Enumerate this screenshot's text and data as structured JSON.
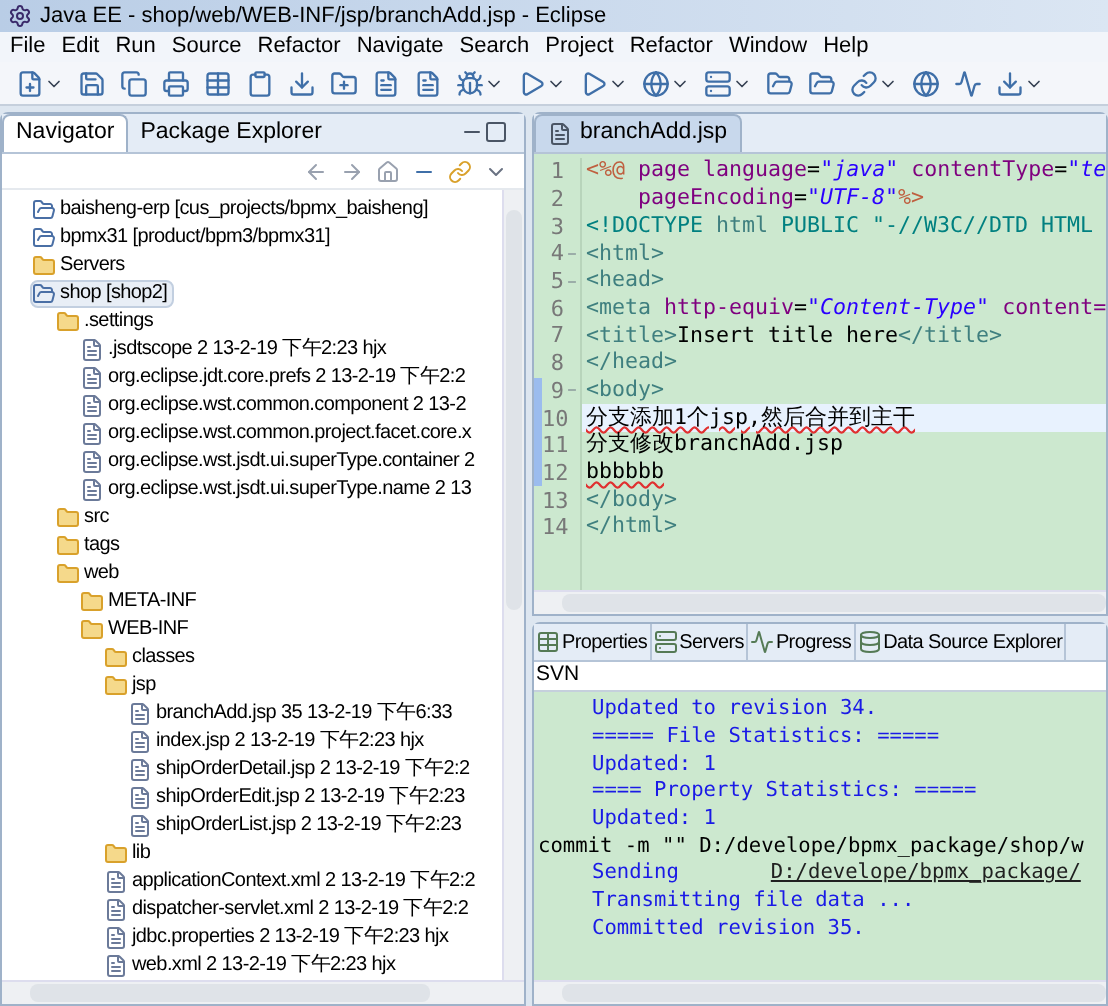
{
  "window": {
    "title": "Java EE - shop/web/WEB-INF/jsp/branchAdd.jsp - Eclipse"
  },
  "menu": [
    "File",
    "Edit",
    "Run",
    "Source",
    "Refactor",
    "Navigate",
    "Search",
    "Project",
    "Refactor",
    "Window",
    "Help"
  ],
  "navigator": {
    "tabs": [
      {
        "label": "Navigator",
        "selected": true
      },
      {
        "label": "Package Explorer",
        "selected": false
      }
    ],
    "tree": [
      {
        "label": "baisheng-erp [cus_projects/bpmx_baisheng]",
        "kind": "project",
        "selected": false
      },
      {
        "label": "bpmx31 [product/bpm3/bpmx31]",
        "kind": "project",
        "selected": false
      },
      {
        "label": "Servers",
        "kind": "folder",
        "selected": false
      },
      {
        "label": "shop [shop2]",
        "kind": "project",
        "selected": true,
        "children": [
          {
            "label": ".settings",
            "kind": "folder",
            "selected": false,
            "children": [
              {
                "label": ".jsdtscope 2  13-2-19 下午2:23  hjx",
                "kind": "file",
                "selected": false
              },
              {
                "label": "org.eclipse.jdt.core.prefs 2  13-2-19 下午2:2",
                "kind": "file",
                "selected": false
              },
              {
                "label": "org.eclipse.wst.common.component 2  13-2",
                "kind": "file",
                "selected": false
              },
              {
                "label": "org.eclipse.wst.common.project.facet.core.x",
                "kind": "file",
                "selected": false
              },
              {
                "label": "org.eclipse.wst.jsdt.ui.superType.container 2",
                "kind": "file",
                "selected": false
              },
              {
                "label": "org.eclipse.wst.jsdt.ui.superType.name 2  13",
                "kind": "file",
                "selected": false
              }
            ]
          },
          {
            "label": "src",
            "kind": "folder",
            "selected": false
          },
          {
            "label": "tags",
            "kind": "folder",
            "selected": false
          },
          {
            "label": "web",
            "kind": "folder",
            "selected": false,
            "children": [
              {
                "label": "META-INF",
                "kind": "folder",
                "selected": false
              },
              {
                "label": "WEB-INF",
                "kind": "folder",
                "selected": false,
                "children": [
                  {
                    "label": "classes",
                    "kind": "folder",
                    "selected": false
                  },
                  {
                    "label": "jsp",
                    "kind": "folder",
                    "selected": false,
                    "children": [
                      {
                        "label": "branchAdd.jsp 35  13-2-19 下午6:33",
                        "kind": "file",
                        "selected": false
                      },
                      {
                        "label": "index.jsp 2  13-2-19 下午2:23  hjx",
                        "kind": "file",
                        "selected": false
                      },
                      {
                        "label": "shipOrderDetail.jsp 2  13-2-19 下午2:2",
                        "kind": "file",
                        "selected": false
                      },
                      {
                        "label": "shipOrderEdit.jsp 2  13-2-19 下午2:23",
                        "kind": "file",
                        "selected": false
                      },
                      {
                        "label": "shipOrderList.jsp 2  13-2-19 下午2:23",
                        "kind": "file",
                        "selected": false
                      }
                    ]
                  },
                  {
                    "label": "lib",
                    "kind": "folder",
                    "selected": false
                  },
                  {
                    "label": "applicationContext.xml 2  13-2-19 下午2:2",
                    "kind": "file",
                    "selected": false
                  },
                  {
                    "label": "dispatcher-servlet.xml 2  13-2-19 下午2:2",
                    "kind": "file",
                    "selected": false
                  },
                  {
                    "label": "jdbc.properties 2  13-2-19 下午2:23  hjx",
                    "kind": "file",
                    "selected": false
                  },
                  {
                    "label": "web.xml 2  13-2-19 下午2:23  hjx",
                    "kind": "file",
                    "selected": false
                  }
                ]
              }
            ]
          }
        ]
      }
    ]
  },
  "editor": {
    "tab": "branchAdd.jsp",
    "lines": [
      {
        "number": "1",
        "fold": false,
        "changed": false,
        "current": false,
        "segments": [
          {
            "text": "<%@",
            "kind": "directive"
          },
          {
            "text": " page ",
            "kind": "attr"
          },
          {
            "text": "language",
            "kind": "attr"
          },
          {
            "text": "=",
            "kind": "plain"
          },
          {
            "text": "\"java\"",
            "kind": "string"
          },
          {
            "text": " contentType",
            "kind": "attr"
          },
          {
            "text": "=",
            "kind": "plain"
          },
          {
            "text": "\"te",
            "kind": "string"
          }
        ]
      },
      {
        "number": "2",
        "fold": false,
        "changed": false,
        "current": false,
        "segments": [
          {
            "text": "    pageEncoding",
            "kind": "attr"
          },
          {
            "text": "=",
            "kind": "plain"
          },
          {
            "text": "\"UTF-8\"",
            "kind": "string"
          },
          {
            "text": "%>",
            "kind": "directive"
          }
        ]
      },
      {
        "number": "3",
        "fold": false,
        "changed": false,
        "current": false,
        "segments": [
          {
            "text": "<!DOCTYPE ",
            "kind": "doctype"
          },
          {
            "text": "html",
            "kind": "tag"
          },
          {
            "text": " PUBLIC \"-//W3C//DTD HTML",
            "kind": "doctype"
          }
        ]
      },
      {
        "number": "4",
        "fold": true,
        "changed": false,
        "current": false,
        "segments": [
          {
            "text": "<html>",
            "kind": "tag"
          }
        ]
      },
      {
        "number": "5",
        "fold": true,
        "changed": false,
        "current": false,
        "segments": [
          {
            "text": "<head>",
            "kind": "tag"
          }
        ]
      },
      {
        "number": "6",
        "fold": false,
        "changed": false,
        "current": false,
        "segments": [
          {
            "text": "<meta ",
            "kind": "tag"
          },
          {
            "text": "http-equiv",
            "kind": "attr"
          },
          {
            "text": "=",
            "kind": "plain"
          },
          {
            "text": "\"Content-Type\"",
            "kind": "string"
          },
          {
            "text": " content=",
            "kind": "attr"
          }
        ]
      },
      {
        "number": "7",
        "fold": false,
        "changed": false,
        "current": false,
        "segments": [
          {
            "text": "<title>",
            "kind": "tag"
          },
          {
            "text": "Insert title here",
            "kind": "plain"
          },
          {
            "text": "</title>",
            "kind": "tag"
          }
        ]
      },
      {
        "number": "8",
        "fold": false,
        "changed": false,
        "current": false,
        "segments": [
          {
            "text": "</head>",
            "kind": "tag"
          }
        ]
      },
      {
        "number": "9",
        "fold": true,
        "changed": true,
        "current": false,
        "segments": [
          {
            "text": "<body>",
            "kind": "tag"
          }
        ]
      },
      {
        "number": "10",
        "fold": false,
        "changed": true,
        "current": true,
        "segments": [
          {
            "text": "分支添加1个jsp,然后合并到主干",
            "kind": "misspelled"
          }
        ]
      },
      {
        "number": "11",
        "fold": false,
        "changed": true,
        "current": false,
        "segments": [
          {
            "text": "分支修改branchAdd.jsp",
            "kind": "plain"
          }
        ]
      },
      {
        "number": "12",
        "fold": false,
        "changed": true,
        "current": false,
        "segments": [
          {
            "text": "bbbbbb",
            "kind": "misspelled"
          }
        ]
      },
      {
        "number": "13",
        "fold": false,
        "changed": false,
        "current": false,
        "segments": [
          {
            "text": "</body>",
            "kind": "tag"
          }
        ]
      },
      {
        "number": "14",
        "fold": false,
        "changed": false,
        "current": false,
        "segments": [
          {
            "text": "</html>",
            "kind": "tag"
          }
        ]
      }
    ]
  },
  "bottom_panel": {
    "tabs": [
      {
        "label": "Properties",
        "selected": false
      },
      {
        "label": "Servers",
        "selected": false
      },
      {
        "label": "Progress",
        "selected": false
      },
      {
        "label": "Data Source Explorer",
        "selected": false
      }
    ],
    "console_title": "SVN",
    "lines": [
      {
        "kind": "info",
        "text": "Updated to revision 34."
      },
      {
        "kind": "info",
        "text": "===== File Statistics: ====="
      },
      {
        "kind": "info",
        "text": "Updated: 1"
      },
      {
        "kind": "info",
        "text": "==== Property Statistics: ====="
      },
      {
        "kind": "info",
        "text": "Updated: 1"
      },
      {
        "kind": "command",
        "text": "commit -m \"\" D:/develope/bpmx_package/shop/w"
      },
      {
        "kind": "link",
        "text": "Sending",
        "link": "D:/develope/bpmx_package/"
      },
      {
        "kind": "info",
        "text": "Transmitting file data ..."
      },
      {
        "kind": "info",
        "text": "Committed revision 35."
      }
    ]
  }
}
